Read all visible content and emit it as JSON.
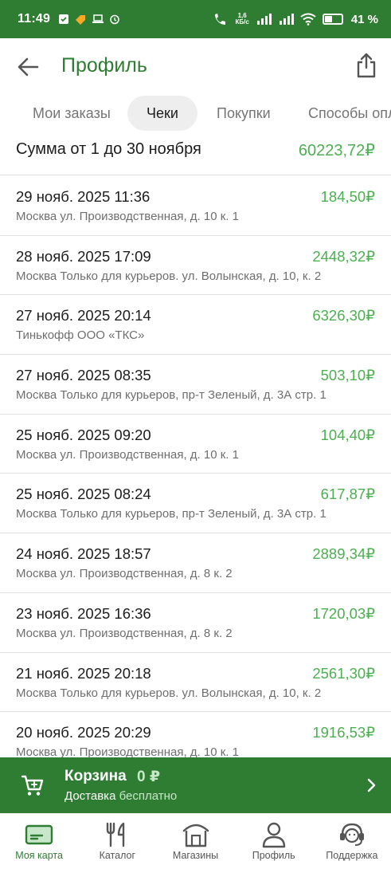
{
  "status_bar": {
    "time": "11:49",
    "net_speed_top": "1,6",
    "net_speed_bottom": "КБ/с",
    "battery": "41 %",
    "battery_level": 0.41
  },
  "header": {
    "title": "Профиль"
  },
  "tabs": [
    {
      "label": "Мои заказы",
      "active": false
    },
    {
      "label": "Чеки",
      "active": true
    },
    {
      "label": "Покупки",
      "active": false
    },
    {
      "label": "Способы оплаты",
      "active": false
    }
  ],
  "summary": {
    "label": "Сумма от 1 до 30 ноября",
    "value": "60223,72₽"
  },
  "receipts": [
    {
      "date": "29 нояб. 2025 11:36",
      "address": "Москва ул. Производственная, д. 10 к. 1",
      "sum": "184,50₽"
    },
    {
      "date": "28 нояб. 2025 17:09",
      "address": "Москва Только для курьеров. ул. Волынская, д. 10, к. 2",
      "sum": "2448,32₽"
    },
    {
      "date": "27 нояб. 2025 20:14",
      "address": "Тинькофф  ООО «ТКС»",
      "sum": "6326,30₽"
    },
    {
      "date": "27 нояб. 2025 08:35",
      "address": "Москва Только для курьеров, пр-т Зеленый, д. 3А стр. 1",
      "sum": "503,10₽"
    },
    {
      "date": "25 нояб. 2025 09:20",
      "address": "Москва ул. Производственная, д. 10 к. 1",
      "sum": "104,40₽"
    },
    {
      "date": "25 нояб. 2025 08:24",
      "address": "Москва Только для курьеров, пр-т Зеленый, д. 3А стр. 1",
      "sum": "617,87₽"
    },
    {
      "date": "24 нояб. 2025 18:57",
      "address": "Москва ул. Производственная, д. 8 к. 2",
      "sum": "2889,34₽"
    },
    {
      "date": "23 нояб. 2025 16:36",
      "address": "Москва ул. Производственная, д. 8 к. 2",
      "sum": "1720,03₽"
    },
    {
      "date": "21 нояб. 2025 20:18",
      "address": "Москва Только для курьеров. ул. Волынская, д. 10, к. 2",
      "sum": "2561,30₽"
    },
    {
      "date": "20 нояб. 2025 20:29",
      "address": "Москва ул. Производственная, д. 10 к. 1",
      "sum": "1916,53₽"
    }
  ],
  "cart": {
    "title": "Корзина",
    "amount": "0 ₽",
    "delivery_label": "Доставка",
    "delivery_value": "бесплатно"
  },
  "bottom_nav": [
    {
      "label": "Моя карта",
      "icon": "card-icon",
      "active": true
    },
    {
      "label": "Каталог",
      "icon": "fork-knife-icon",
      "active": false
    },
    {
      "label": "Магазины",
      "icon": "store-icon",
      "active": false
    },
    {
      "label": "Профиль",
      "icon": "person-icon",
      "active": false
    },
    {
      "label": "Поддержка",
      "icon": "support-icon",
      "active": false
    }
  ],
  "colors": {
    "brand_green": "#2e7d32",
    "amount_green": "#4caf50"
  }
}
